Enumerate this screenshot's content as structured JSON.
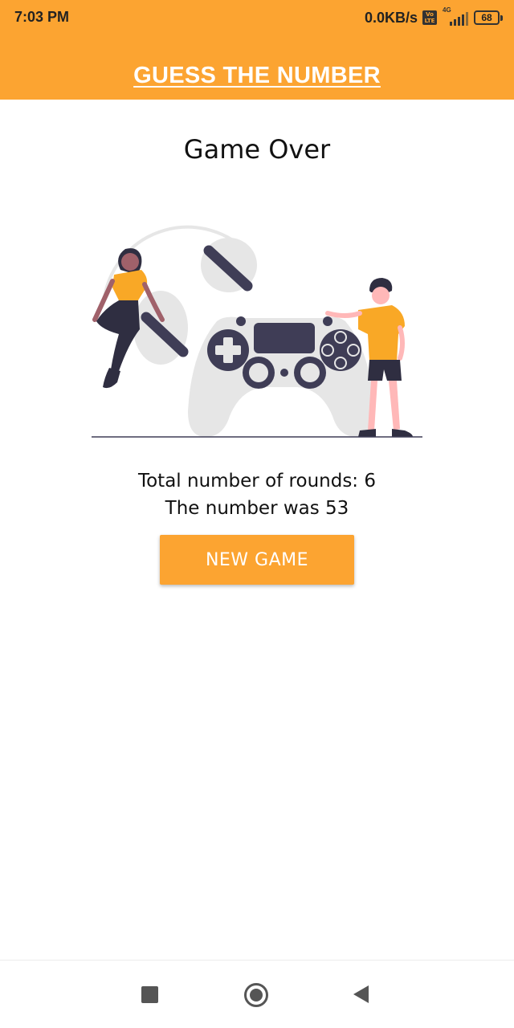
{
  "status_bar": {
    "time": "7:03 PM",
    "net_speed": "0.0KB/s",
    "volte": "Vo LTE",
    "network_type": "4G",
    "battery": "68"
  },
  "header": {
    "title": "GUESS THE NUMBER",
    "color": "#FCA431"
  },
  "game_over": {
    "title": "Game Over",
    "rounds_text": "Total number of rounds: 6",
    "number_text": "The number was 53",
    "new_game_label": "NEW GAME"
  },
  "illustration": {
    "icon": "gamers-controller-illustration",
    "accent": "#F9A826",
    "dark": "#3F3D56",
    "controller": "#E6E6E6"
  },
  "nav": {
    "recent_icon": "square-icon",
    "home_icon": "circle-icon",
    "back_icon": "triangle-back-icon"
  }
}
